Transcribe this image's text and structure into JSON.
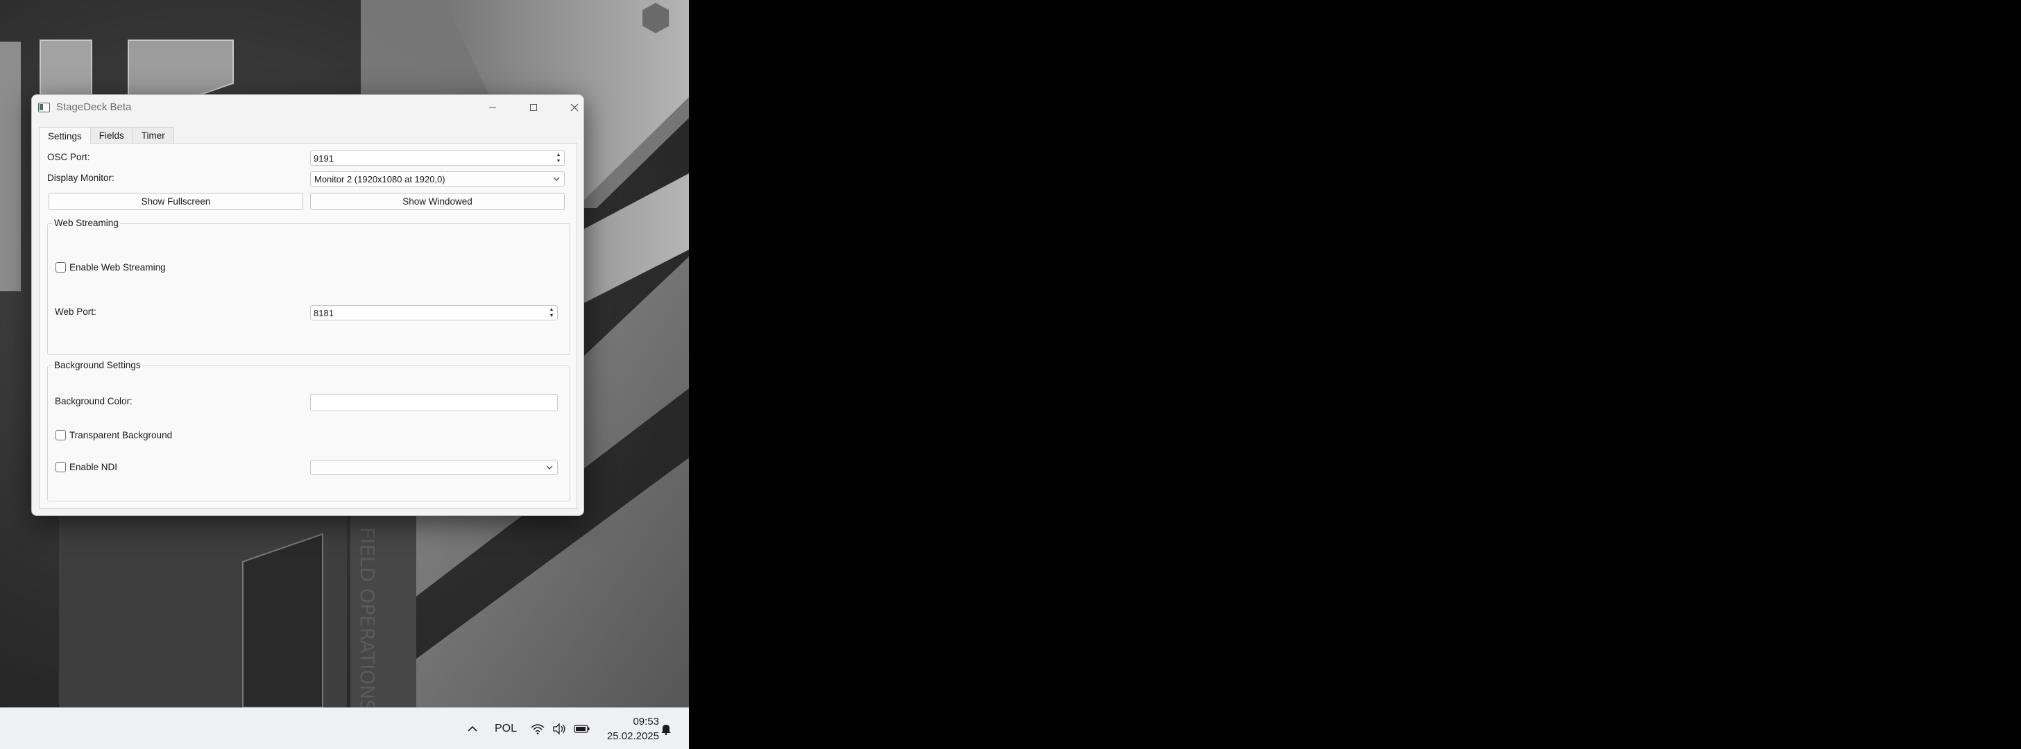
{
  "window": {
    "title": "StageDeck Beta",
    "controls": {
      "minimize": "minimize-icon",
      "maximize": "maximize-icon",
      "close": "close-icon"
    }
  },
  "tabs": [
    {
      "label": "Settings",
      "active": true
    },
    {
      "label": "Fields",
      "active": false
    },
    {
      "label": "Timer",
      "active": false
    }
  ],
  "settings": {
    "osc_port": {
      "label": "OSC Port:",
      "value": "9191"
    },
    "display_monitor": {
      "label": "Display Monitor:",
      "value": "Monitor 2 (1920x1080 at 1920,0)"
    },
    "show_fullscreen": "Show Fullscreen",
    "show_windowed": "Show Windowed",
    "web_streaming": {
      "title": "Web Streaming",
      "enable_label": "Enable Web Streaming",
      "enable_checked": false,
      "web_port_label": "Web Port:",
      "web_port_value": "8181"
    },
    "background": {
      "title": "Background Settings",
      "color_label": "Background Color:",
      "color_value": "",
      "transparent_label": "Transparent Background",
      "transparent_checked": false,
      "ndi_label": "Enable NDI",
      "ndi_checked": false,
      "ndi_source": ""
    }
  },
  "taskbar": {
    "language": "POL",
    "time": "09:53",
    "date": "25.02.2025",
    "icons": [
      "chevron-up-icon",
      "wifi-icon",
      "volume-icon",
      "battery-icon",
      "notification-bell-icon"
    ]
  },
  "colors": {
    "desktop_dark": "#2e2e2e",
    "window_bg": "#f3f3f3",
    "taskbar_bg": "#eef0f3",
    "checkbox_accent": "#3b7a57"
  }
}
